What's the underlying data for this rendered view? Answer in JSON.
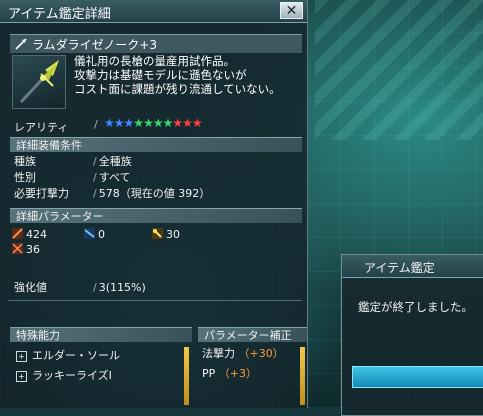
{
  "window": {
    "title": "アイテム鑑定詳細",
    "close_label": "✕"
  },
  "item": {
    "name": "ラムダライゼノーク+3",
    "description_lines": [
      "儀礼用の長槍の量産用試作品。",
      "攻撃力は基礎モデルに遜色ないが",
      "コスト面に課題が残り流通していない。"
    ],
    "rarity_label": "レアリティ",
    "rarity_stars": 10,
    "star_colors": [
      "#3f86ff",
      "#3f86ff",
      "#3f86ff",
      "#38d96a",
      "#38d96a",
      "#38d96a",
      "#38d96a",
      "#ff4040",
      "#ff4040",
      "#ff4040"
    ]
  },
  "equip_conditions": {
    "header": "詳細装備条件",
    "rows": [
      {
        "label": "種族",
        "value": "全種族"
      },
      {
        "label": "性別",
        "value": "すべて"
      },
      {
        "label": "必要打撃力",
        "value": "578（現在の値 392）"
      }
    ]
  },
  "parameters": {
    "header": "詳細パラメーター",
    "stats": [
      {
        "icon": "sword-attack-icon",
        "value": "424",
        "color": "#e06a3a"
      },
      {
        "icon": "gun-attack-icon",
        "value": "0",
        "color": "#4aa6e8"
      },
      {
        "icon": "tech-attack-icon",
        "value": "30",
        "color": "#e8c84a"
      },
      {
        "icon": "dexterity-icon",
        "value": "36",
        "color": "#d45a3a"
      }
    ]
  },
  "grind": {
    "label": "強化値",
    "value": "3(115%)"
  },
  "special_abilities": {
    "header": "特殊能力",
    "items": [
      "エルダー・ソール",
      "ラッキーライズI"
    ]
  },
  "param_bonus": {
    "header": "パラメーター補正",
    "items": [
      {
        "label": "法撃力",
        "value": "（+30）"
      },
      {
        "label": "PP",
        "value": "（+3）"
      }
    ]
  },
  "popup": {
    "title": "アイテム鑑定",
    "message": "鑑定が終了しました。"
  }
}
